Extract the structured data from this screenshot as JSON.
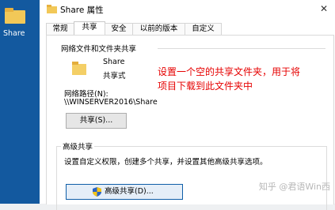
{
  "desktop": {
    "icon_label": "Share"
  },
  "window": {
    "title": "Share 属性",
    "close": "✕"
  },
  "tabs": [
    {
      "label": "常规"
    },
    {
      "label": "共享"
    },
    {
      "label": "安全"
    },
    {
      "label": "以前的版本"
    },
    {
      "label": "自定义"
    }
  ],
  "network_share": {
    "group_title": "网络文件和文件夹共享",
    "name": "Share",
    "status": "共享式",
    "path_label": "网络路径(N):",
    "path_value": "\\\\WINSERVER2016\\Share",
    "share_button": "共享(S)..."
  },
  "advanced": {
    "group_title": "高级共享",
    "description": "设置自定义权限，创建多个共享，并设置其他高级共享选项。",
    "button": "高级共享(D)..."
  },
  "annotation": {
    "line1": "设置一个空的共享文件夹，用于将",
    "line2": "项目下载到此文件夹中"
  },
  "watermark": "知乎 @君语Win西",
  "icons": {
    "desktop_folder": "folder-icon",
    "share_folder": "folder-icon",
    "shield": "uac-shield-icon"
  }
}
